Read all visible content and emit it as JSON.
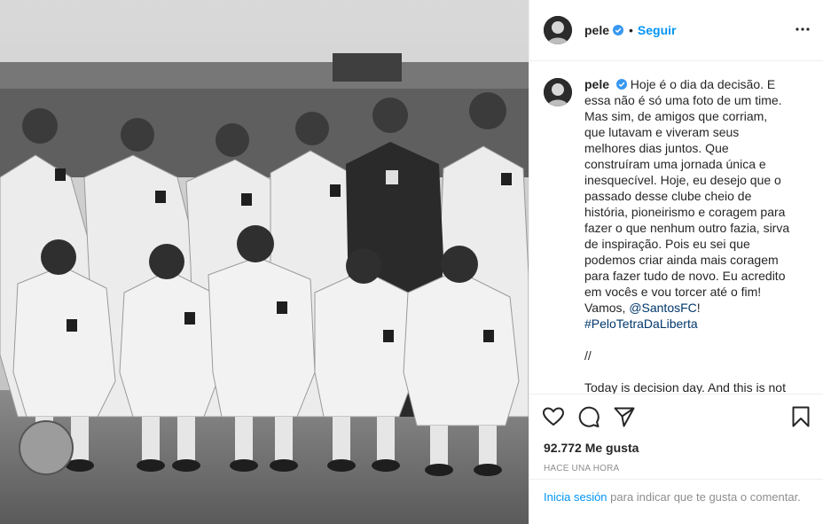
{
  "header": {
    "username": "pele",
    "separator": "•",
    "follow_label": "Seguir"
  },
  "caption": {
    "username": "pele",
    "text_1": "Hoje é o dia da decisão. E essa não é só uma foto de um time. Mas sim, de amigos que corriam, que lutavam e viveram seus melhores dias juntos. Que construíram uma jornada única e inesquecível. Hoje, eu desejo que o passado desse clube cheio de história, pioneirismo e coragem para fazer o que nenhum outro fazia, sirva de inspiração. Pois eu sei que podemos criar ainda mais coragem para fazer tudo de novo. Eu acredito em vocês e vou torcer até o fim! Vamos, ",
    "mention": "@SantosFC",
    "text_2": "!",
    "hashtag": "#PeloTetraDaLiberta",
    "divider": "//",
    "english": "Today is decision day. And this is not just a photo of a team. It's a photo of"
  },
  "stats": {
    "likes": "92.772 Me gusta",
    "time": "HACE UNA HORA"
  },
  "login": {
    "signin_label": "Inicia sesión",
    "rest_text": " para indicar que te gusta o comentar."
  },
  "icons": {
    "like": "heart-icon",
    "comment": "comment-icon",
    "share": "share-icon",
    "save": "bookmark-icon",
    "more": "more-options-icon",
    "verified": "verified-badge-icon"
  },
  "colors": {
    "link_blue": "#0095f6",
    "mention_blue": "#00376b",
    "text": "#262626",
    "muted": "#8e8e8e",
    "border": "#efefef"
  }
}
